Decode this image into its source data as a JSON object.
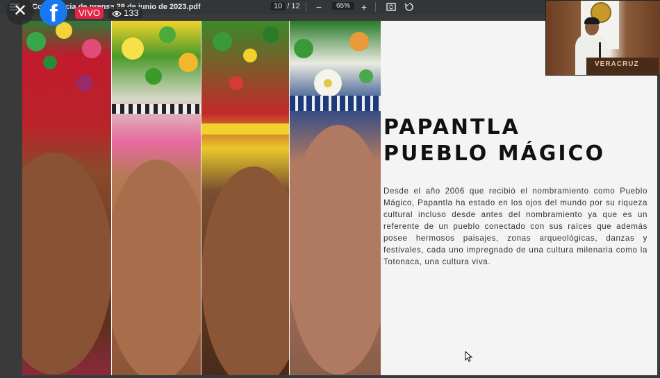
{
  "viewer": {
    "title": "Conferencia de prensa 28 de junio de 2023.pdf",
    "page_current": "10",
    "page_total": "/ 12",
    "zoom": "65%",
    "zoom_out": "−",
    "zoom_in": "+"
  },
  "live": {
    "close_glyph": "✕",
    "fb_glyph": "f",
    "badge": "VIVO",
    "viewer_count": "133"
  },
  "slide": {
    "title_line1": "PAPANTLA",
    "title_line2": "PUEBLO MÁGICO",
    "body": "Desde el año 2006 que recibió el nombramiento como Pueblo Mágico, Papantla ha estado en los ojos del mundo por su riqueza cultural incluso desde antes del nombramiento ya que es un referente de un pueblo conectado con sus raíces que además posee hermosos paisajes, zonas arqueológicas, danzas y festivales, cada uno impregnado de una cultura milenaria como la Totonaca, una cultura viva."
  },
  "webcam": {
    "podium_text": "VERACRUZ"
  },
  "colors": {
    "toolbar": "#323639",
    "live_red": "#e42645",
    "facebook_blue": "#1877f2"
  },
  "icons": [
    "menu-icon",
    "close-icon",
    "facebook-logo-icon",
    "eye-icon",
    "fit-page-icon",
    "rotate-icon",
    "mouse-cursor-icon"
  ]
}
